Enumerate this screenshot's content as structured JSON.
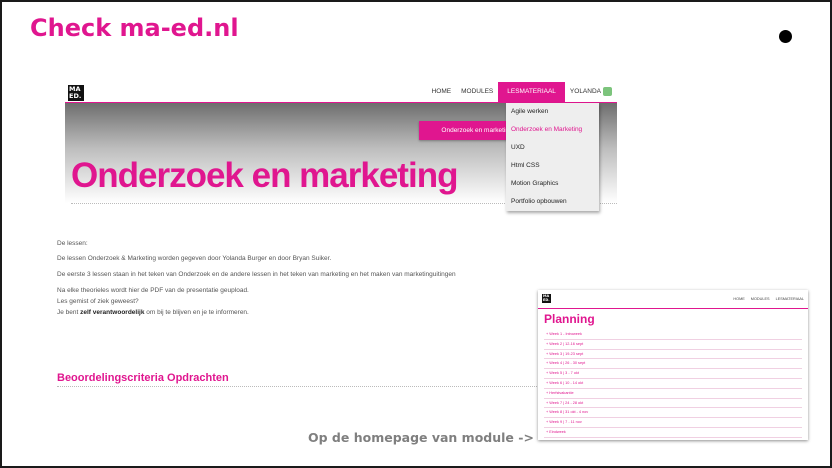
{
  "slide": {
    "title": "Check ma-ed.nl",
    "caption": "Op de homepage van module ->"
  },
  "site": {
    "logo": [
      "MA",
      "ED."
    ],
    "nav": [
      "HOME",
      "MODULES",
      "LESMATERIAAL",
      "YOLANDA"
    ],
    "hero_button": "Onderzoek en marketing",
    "hero_title": "Onderzoek en marketing",
    "dropdown": [
      "Agile werken",
      "Onderzoek en Marketing",
      "UXD",
      "Html CSS",
      "Motion Graphics",
      "Portfolio opbouwen"
    ],
    "body": {
      "line1": "De lessen:",
      "line2": "De lessen Onderzoek & Marketing worden gegeven door Yolanda Burger en door Bryan Suiker.",
      "line3": "De eerste 3 lessen staan in het teken van Onderzoek en de andere lessen in het teken van marketing en het maken van marketinguitingen",
      "line4": "Na elke theorieles wordt hier de PDF van de presentatie geupload.",
      "line5": "Les gemist of ziek geweest?",
      "line6_a": "Je bent ",
      "line6_b": "zelf verantwoordelijk",
      "line6_c": " om bij te blijven en je te informeren."
    },
    "section_heading": "Beoordelingscriteria Opdrachten"
  },
  "planning": {
    "logo": [
      "MA",
      "ED."
    ],
    "nav": [
      "HOME",
      "MODULES",
      "LESMATERIAAL"
    ],
    "title": "Planning",
    "rows": [
      "Week 1 - Introweek",
      "Week 2 | 12-16 sept",
      "Week 3 | 19-23 sept",
      "Week 4 | 26 - 30 sept",
      "Week 5 | 3 - 7 okt",
      "Week 6 | 10 - 14 okt",
      "Herfstvakantie",
      "Week 7 | 24 - 28 okt",
      "Week 8 | 31 okt - 4 nov",
      "Week 9 | 7 - 11 nov",
      "Eindweek"
    ]
  }
}
